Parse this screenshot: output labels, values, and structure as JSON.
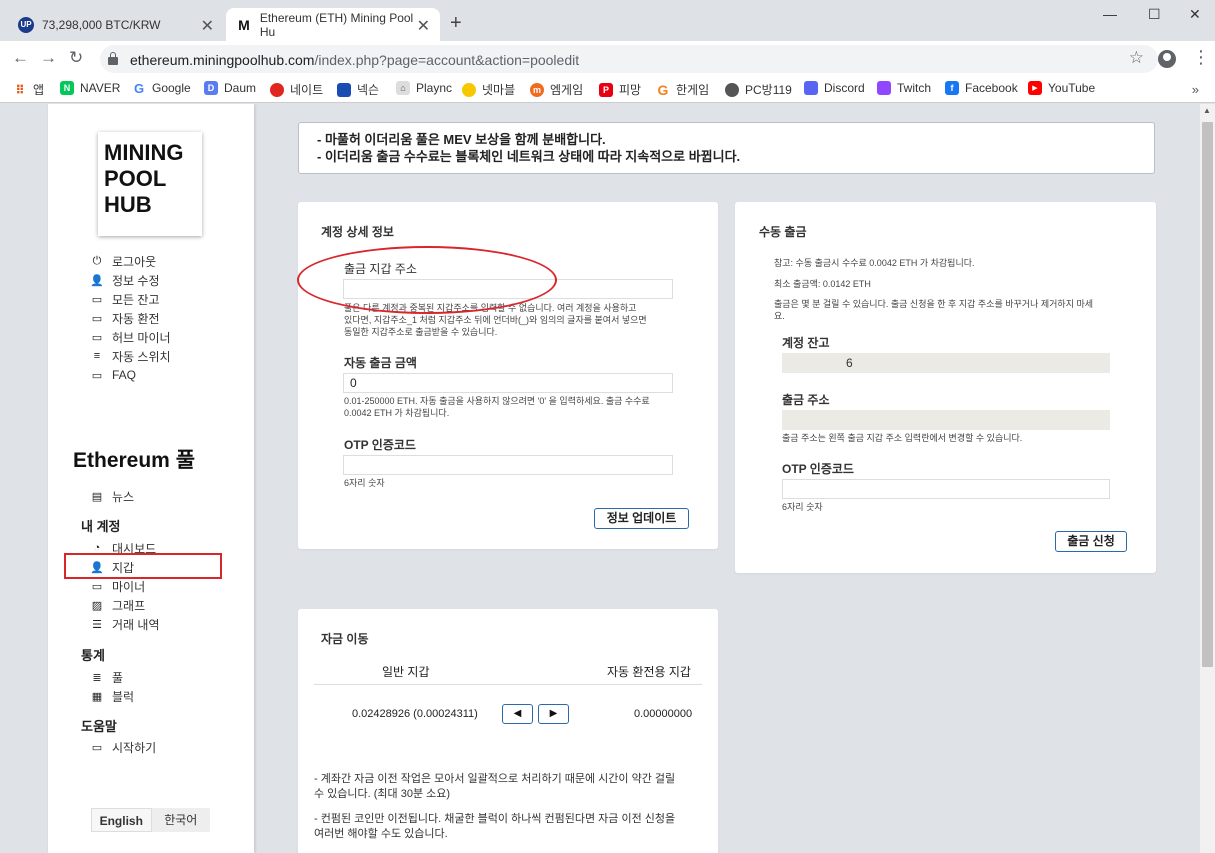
{
  "browser": {
    "tabs": [
      {
        "title": "73,298,000 BTC/KRW",
        "favicon": "UP"
      },
      {
        "title": "Ethereum (ETH) Mining Pool Hu",
        "favicon": "M"
      }
    ],
    "url_host": "ethereum.miningpoolhub.com",
    "url_path": "/index.php?page=account&action=pooledit",
    "bookmarks": [
      "앱",
      "NAVER",
      "Google",
      "Daum",
      "네이트",
      "넥슨",
      "Plaync",
      "넷마블",
      "엠게임",
      "피망",
      "한게임",
      "PC방119",
      "Discord",
      "Twitch",
      "Facebook",
      "YouTube"
    ]
  },
  "sidebar": {
    "logo": [
      "MINING",
      "POOL",
      "HUB"
    ],
    "account_menu": [
      "로그아웃",
      "정보 수정",
      "모든 잔고",
      "자동 환전",
      "허브 마이너",
      "자동 스위치",
      "FAQ"
    ],
    "pool_title": "Ethereum 풀",
    "news": "뉴스",
    "my_account_label": "내 계정",
    "my_account_items": [
      "대시보드",
      "지갑",
      "마이너",
      "그래프",
      "거래 내역"
    ],
    "stats_label": "통계",
    "stats_items": [
      "풀",
      "블럭"
    ],
    "help_label": "도움말",
    "help_items": [
      "시작하기"
    ],
    "lang_en": "English",
    "lang_ko": "한국어"
  },
  "notice": {
    "line1_pre": "- 마풀허 이더리움 풀은 ",
    "line1_mev": "MEV",
    "line1_post": " 보상을 함께 분배합니다.",
    "line2": "- 이더리움 출금 수수료는 블록체인 네트워크 상태에 따라 지속적으로 바뀝니다."
  },
  "account_details": {
    "title": "계정 상세 정보",
    "wallet_label": "출금 지갑 주소",
    "wallet_value": "",
    "wallet_help1": "풀은 다른 계정과 중복된 지갑주소를 입력할 수 없습니다. 여러 계정을 사용하고",
    "wallet_help2": "있다면, 지갑주소_1 처럼 지갑주소 뒤에 언더바(_)와 임의의 글자를 붙여서 넣으면",
    "wallet_help3": "동일한 지갑주소로 출금받을 수 있습니다.",
    "auto_label": "자동 출금 금액",
    "auto_value": "0",
    "auto_help1": "0.01-250000 ETH. 자동 출금을 사용하지 않으려면 '0' 을 입력하세요. 출금 수수료",
    "auto_help2": "0.0042 ETH 가 차감됩니다.",
    "otp_label": "OTP 인증코드",
    "otp_help": "6자리 숫자",
    "update_button": "정보 업데이트"
  },
  "manual_withdraw": {
    "title": "수동 출금",
    "note1": "참고: 수동 출금시 수수료 0.0042 ETH 가 차감됩니다.",
    "note2": "최소 출금액: 0.0142 ETH",
    "note3a": "출금은 몇 분 걸릴 수 있습니다. 출금 신청을 한 후 지갑 주소를 바꾸거나 제거하지 마세",
    "note3b": "요.",
    "balance_label": "계정 잔고",
    "balance_value": "6",
    "address_label": "출금 주소",
    "address_help": "출금 주소는 왼쪽 출금 지갑 주소 입력란에서 변경할 수 있습니다.",
    "otp_label": "OTP 인증코드",
    "otp_help": "6자리 숫자",
    "request_button": "출금 신청"
  },
  "transfer": {
    "title": "자금 이동",
    "col_general": "일반 지갑",
    "col_auto": "자동 환전용 지갑",
    "general_value": "0.02428926 (0.00024311)",
    "auto_value": "0.00000000",
    "note1a": "- 계좌간 자금 이전 작업은 모아서 일괄적으로 처리하기 때문에 시간이 약간 걸릴",
    "note1b": "수 있습니다. (최대 30분 소요)",
    "note2a": "- 컨펌된 코인만 이전됩니다. 채굴한 블럭이 하나씩 컨펌된다면 자금 이전 신청을",
    "note2b": "여러번 해야할 수도 있습니다."
  }
}
